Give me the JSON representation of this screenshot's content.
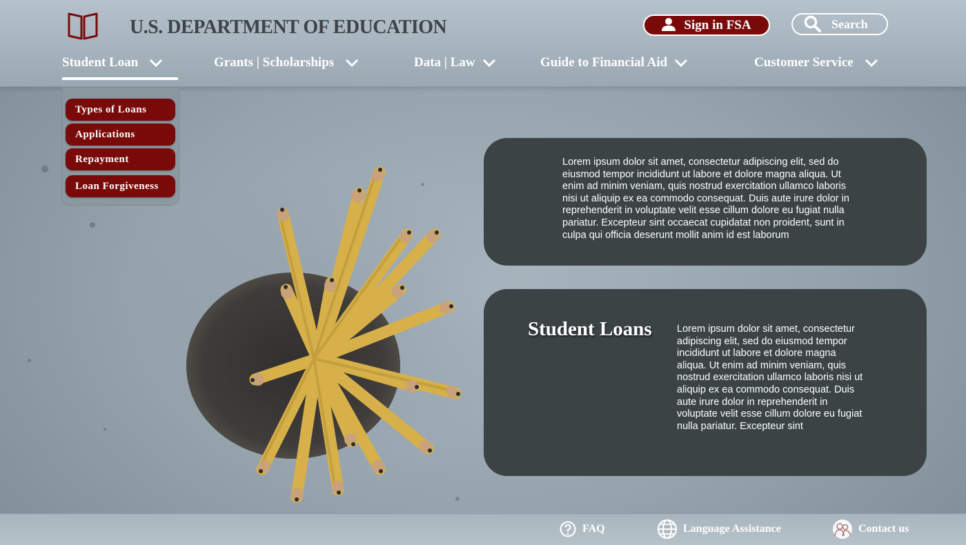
{
  "header": {
    "title": "U.S. DEPARTMENT OF EDUCATION",
    "logo_icon": "open-book-icon",
    "signin_label": "Sign in FSA",
    "search_label": "Search"
  },
  "nav": {
    "items": [
      {
        "label": "Student Loan",
        "active": true
      },
      {
        "label": "Grants | Scholarships"
      },
      {
        "label": "Data | Law"
      },
      {
        "label": "Guide to Financial Aid"
      },
      {
        "label": "Customer Service"
      }
    ]
  },
  "dropdown": {
    "items": [
      {
        "label": "Types of Loans"
      },
      {
        "label": "Applications"
      },
      {
        "label": "Repayment"
      },
      {
        "label": "Loan Forgiveness"
      }
    ]
  },
  "main": {
    "card1_text": "Lorem ipsum dolor sit amet, consectetur adipiscing elit, sed do eiusmod tempor incididunt ut labore et dolore magna aliqua. Ut enim ad minim veniam, quis nostrud exercitation ullamco laboris nisi ut aliquip ex ea commodo consequat. Duis aute irure dolor in reprehenderit in voluptate velit esse cillum dolore eu fugiat nulla pariatur. Excepteur sint occaecat cupidatat non proident, sunt in culpa qui officia deserunt mollit anim id est laborum",
    "card2_title": "Student Loans",
    "card2_text": "Lorem ipsum dolor sit amet, consectetur adipiscing elit, sed do eiusmod tempor incididunt ut labore et dolore magna aliqua. Ut enim ad minim veniam, quis nostrud exercitation ullamco laboris nisi ut aliquip ex ea commodo consequat. Duis aute irure dolor in reprehenderit in voluptate velit esse cillum dolore eu fugiat nulla pariatur. Excepteur sint"
  },
  "footer": {
    "links": [
      {
        "label": "FAQ",
        "icon": "question-icon"
      },
      {
        "label": "Language Assistance",
        "icon": "globe-icon"
      },
      {
        "label": "Contact us",
        "icon": "people-icon"
      }
    ]
  },
  "colors": {
    "brand_red": "#7a0a0a",
    "card_bg": "#3b4345",
    "header_bg": "#a5b2bc"
  }
}
